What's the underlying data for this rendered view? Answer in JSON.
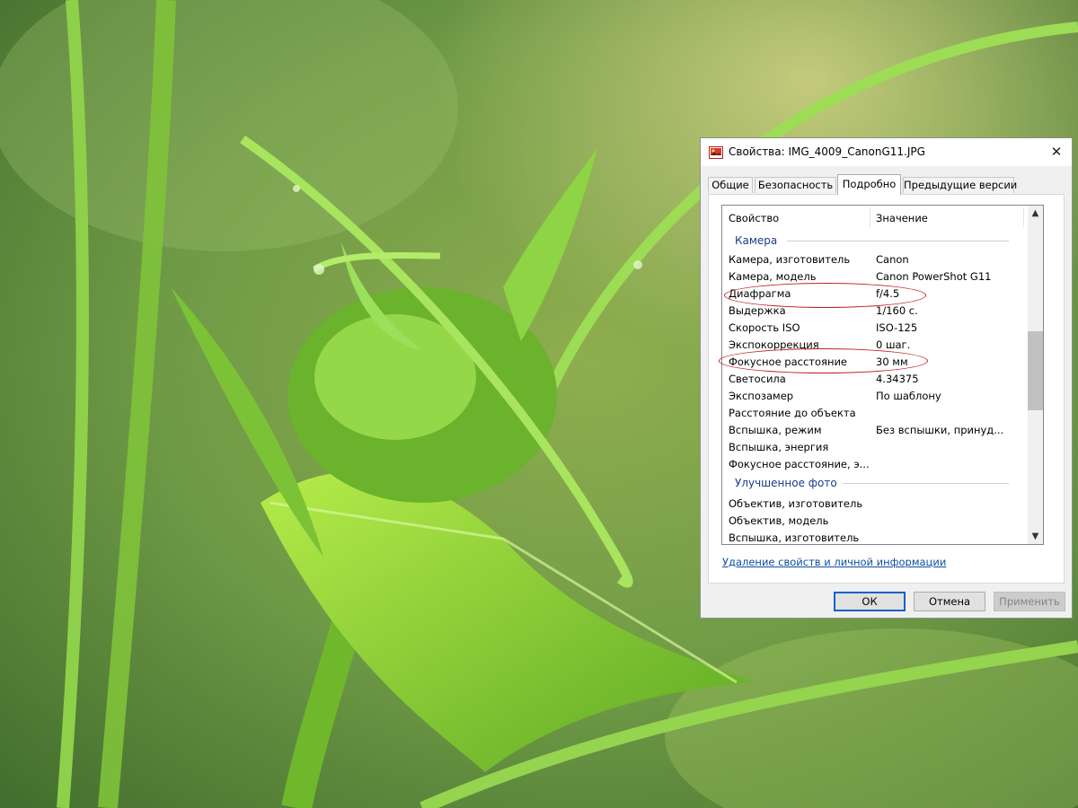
{
  "dialog": {
    "title": "Свойства: IMG_4009_CanonG11.JPG",
    "close_glyph": "✕",
    "tabs": [
      {
        "label": "Общие",
        "active": false
      },
      {
        "label": "Безопасность",
        "active": false
      },
      {
        "label": "Подробно",
        "active": true
      },
      {
        "label": "Предыдущие версии",
        "active": false
      }
    ],
    "columns": {
      "property": "Свойство",
      "value": "Значение"
    },
    "groups": [
      {
        "name": "Камера",
        "rows": [
          {
            "property": "Камера, изготовитель",
            "value": "Canon"
          },
          {
            "property": "Камера, модель",
            "value": "Canon PowerShot G11"
          },
          {
            "property": "Диафрагма",
            "value": "f/4.5",
            "highlighted": true
          },
          {
            "property": "Выдержка",
            "value": "1/160 с."
          },
          {
            "property": "Скорость ISO",
            "value": "ISO-125"
          },
          {
            "property": "Экспокоррекция",
            "value": "0 шаг."
          },
          {
            "property": "Фокусное расстояние",
            "value": "30 мм",
            "highlighted": true
          },
          {
            "property": "Светосила",
            "value": "4.34375"
          },
          {
            "property": "Экспозамер",
            "value": "По шаблону"
          },
          {
            "property": "Расстояние до объекта",
            "value": ""
          },
          {
            "property": "Вспышка, режим",
            "value": "Без вспышки, принуд..."
          },
          {
            "property": "Вспышка, энергия",
            "value": ""
          },
          {
            "property": "Фокусное расстояние, э...",
            "value": ""
          }
        ]
      },
      {
        "name": "Улучшенное фото",
        "rows": [
          {
            "property": "Объектив, изготовитель",
            "value": ""
          },
          {
            "property": "Объектив, модель",
            "value": ""
          },
          {
            "property": "Вспышка, изготовитель",
            "value": ""
          }
        ]
      }
    ],
    "scroll_up": "▲",
    "scroll_down": "▼",
    "remove_link": "Удаление свойств и личной информации",
    "buttons": {
      "ok": "ОК",
      "cancel": "Отмена",
      "apply": "Применить"
    },
    "highlight_color": "#c21e29"
  }
}
